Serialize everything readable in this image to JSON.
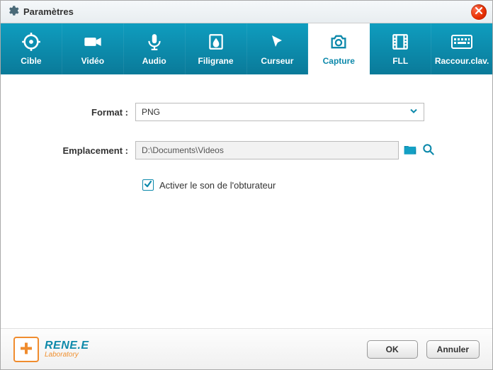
{
  "window": {
    "title": "Paramètres"
  },
  "tabs": {
    "0": {
      "label": "Cible"
    },
    "1": {
      "label": "Vidéo"
    },
    "2": {
      "label": "Audio"
    },
    "3": {
      "label": "Filigrane"
    },
    "4": {
      "label": "Curseur"
    },
    "5": {
      "label": "Capture",
      "active": true
    },
    "6": {
      "label": "FLL"
    },
    "7": {
      "label": "Raccour.clav."
    }
  },
  "form": {
    "format_label": "Format :",
    "format_value": "PNG",
    "location_label": "Emplacement :",
    "location_value": "D:\\Documents\\Videos",
    "shutter_label": "Activer le son de l'obturateur",
    "shutter_checked": true
  },
  "footer": {
    "brand": "RENE.E",
    "brand_sub": "Laboratory",
    "ok": "OK",
    "cancel": "Annuler"
  },
  "colors": {
    "accent": "#0d89ab"
  }
}
